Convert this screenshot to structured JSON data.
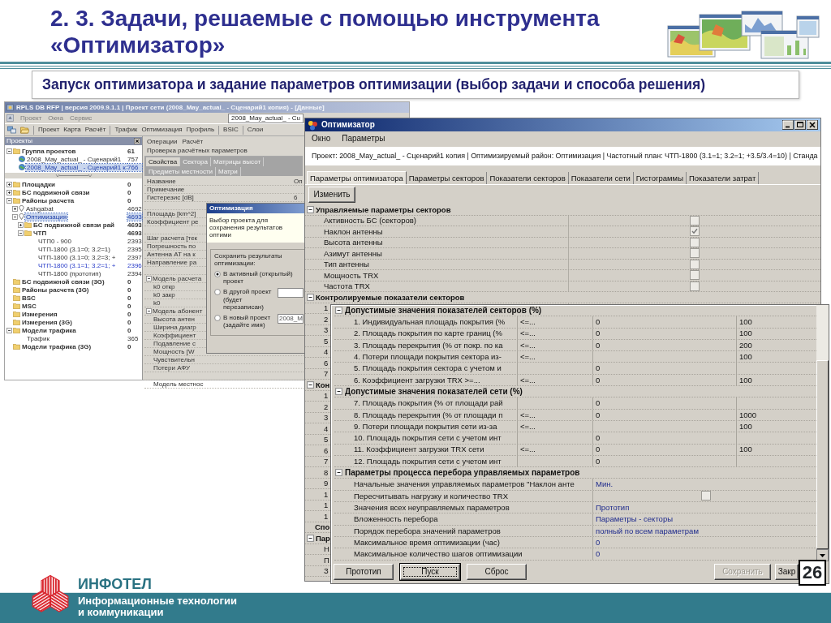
{
  "slide": {
    "title": "2. 3. Задачи, решаемые с помощью инструмента «Оптимизатор»",
    "subtitle": "Запуск оптимизатора и задание параметров оптимизации (выбор задачи и способа решения)",
    "page_number": "26"
  },
  "main_window": {
    "title": "RPLS DB RFP | версия 2009.9.1.1 | Проект сети (2008_May_actual_ - Сценарий1 копия) - [Данные]",
    "menu": [
      "Проект",
      "Окна",
      "Сервис"
    ],
    "toolbar": [
      "Проект",
      "Карта",
      "Расчёт",
      "Трафик",
      "Оптимизация",
      "Профиль",
      "BSIC",
      "Слои"
    ],
    "layer_combo": "2008_May_actual_ - Cu",
    "projects_panel": {
      "title": "Проекты",
      "tree": [
        {
          "label": "Группа проектов",
          "count": "61",
          "kind": "folder",
          "expanded": true,
          "selected": false,
          "children": [
            {
              "label": "2008_May_actual_ - Сценарий1",
              "count": "757",
              "kind": "project",
              "selected": false
            },
            {
              "label": "2008_May_actual_ - Сценарий1 к",
              "count": "766",
              "kind": "project",
              "selected": true
            }
          ]
        }
      ]
    },
    "objects_tree": [
      {
        "label": "Площадки",
        "count": "0",
        "kind": "folder",
        "expanded": false,
        "selected": false
      },
      {
        "label": "БС подвижной связи",
        "count": "0",
        "kind": "folder",
        "expanded": false,
        "selected": false
      },
      {
        "label": "Районы расчета",
        "count": "0",
        "kind": "folder",
        "expanded": true,
        "selected": false,
        "children": [
          {
            "label": "Ashgabat",
            "count": "4692",
            "kind": "area",
            "expanded": false,
            "selected": false
          },
          {
            "label": "Оптимизация",
            "count": "4693",
            "kind": "area",
            "expanded": true,
            "selected": true,
            "children": [
              {
                "label": "БС подвижной связи рай",
                "count": "4693",
                "kind": "folder",
                "expanded": false,
                "selected": false
              },
              {
                "label": "ЧТП",
                "count": "4693",
                "kind": "folder",
                "expanded": true,
                "selected": false,
                "children": [
                  {
                    "label": "ЧТП0 - 900",
                    "count": "2393",
                    "kind": "plan",
                    "selected": false,
                    "active": false
                  },
                  {
                    "label": "ЧТП-1800 (3.1=0; 3.2=1)",
                    "count": "2395",
                    "kind": "plan",
                    "selected": false,
                    "active": false
                  },
                  {
                    "label": "ЧТП-1800 (3.1=0; 3.2=3; +",
                    "count": "2397",
                    "kind": "plan",
                    "selected": false,
                    "active": false
                  },
                  {
                    "label": "ЧТП-1800 (3.1=1; 3.2=1; +",
                    "count": "2396",
                    "kind": "plan",
                    "selected": false,
                    "active": true
                  },
                  {
                    "label": "ЧТП-1800 (прототип)",
                    "count": "2394",
                    "kind": "plan",
                    "selected": false,
                    "active": false
                  }
                ]
              }
            ]
          }
        ]
      },
      {
        "label": "БС подвижной связи (3G)",
        "count": "0",
        "kind": "folder",
        "selected": false
      },
      {
        "label": "Районы расчета (3G)",
        "count": "0",
        "kind": "folder",
        "selected": false
      },
      {
        "label": "BSC",
        "count": "0",
        "kind": "folder",
        "selected": false
      },
      {
        "label": "MSC",
        "count": "0",
        "kind": "folder",
        "selected": false
      },
      {
        "label": "Измерения",
        "count": "0",
        "kind": "folder",
        "selected": false
      },
      {
        "label": "Измерения (3G)",
        "count": "0",
        "kind": "folder",
        "selected": false
      },
      {
        "label": "Модели трафика",
        "count": "0",
        "kind": "folder",
        "expanded": true,
        "selected": false,
        "children": [
          {
            "label": "Трафик",
            "count": "365",
            "kind": "plan",
            "selected": false
          }
        ]
      },
      {
        "label": "Модели трафика (3G)",
        "count": "0",
        "kind": "folder",
        "selected": false
      }
    ],
    "actions": [
      "Операции",
      "Расчёт",
      "Проверка расчётных параметров"
    ],
    "tabs": [
      {
        "label": "Свойства",
        "selected": true
      },
      {
        "label": "Сектора",
        "selected": false
      },
      {
        "label": "Матрицы высот",
        "selected": false
      },
      {
        "label": "Предметы местности",
        "selected": false
      },
      {
        "label": "Матри",
        "selected": false
      }
    ],
    "properties": [
      {
        "kind": "row",
        "name": "Название",
        "value": "Оп"
      },
      {
        "kind": "row",
        "name": "Примечание"
      },
      {
        "kind": "row",
        "name": "Гистерезис [dB]",
        "value": "6"
      },
      {
        "kind": "spacer"
      },
      {
        "kind": "row",
        "name": "Площадь [km^2]"
      },
      {
        "kind": "row",
        "name": "Коэффициент ре"
      },
      {
        "kind": "spacer"
      },
      {
        "kind": "row",
        "name": "Шаг расчета [тек"
      },
      {
        "kind": "row",
        "name": "Погрешность по"
      },
      {
        "kind": "row",
        "name": "Антенна АТ на к"
      },
      {
        "kind": "row",
        "name": "Направление ра"
      },
      {
        "kind": "spacer"
      },
      {
        "kind": "section",
        "name": "Модель расчета",
        "expanded": true
      },
      {
        "kind": "row",
        "name": "k0 откр"
      },
      {
        "kind": "row",
        "name": "k0 закр"
      },
      {
        "kind": "row",
        "name": "k0"
      },
      {
        "kind": "section",
        "name": "Модель абонент",
        "expanded": true
      },
      {
        "kind": "row",
        "name": "Высота антен"
      },
      {
        "kind": "row",
        "name": "Ширина диагр"
      },
      {
        "kind": "row",
        "name": "Коэффициент"
      },
      {
        "kind": "row",
        "name": "Подавление с"
      },
      {
        "kind": "row",
        "name": "Мощность [W"
      },
      {
        "kind": "row",
        "name": "Чувствительн"
      },
      {
        "kind": "row",
        "name": "Потери АФУ"
      },
      {
        "kind": "spacer"
      },
      {
        "kind": "row",
        "name": "Модель местнос"
      }
    ]
  },
  "save_dialog": {
    "title": "Оптимизация",
    "hint": "Выбор проекта для сохранения результатов оптими",
    "group": "Сохранить результаты оптимизации:",
    "options": [
      {
        "label": "В активный (открытый) проект",
        "selected": true,
        "kind": "plain"
      },
      {
        "label": "В другой проект (будет перезаписан)",
        "selected": false,
        "kind": "dropdown"
      },
      {
        "label": "В новый проект (задайте имя)",
        "selected": false,
        "kind": "input",
        "value": "2008_M"
      }
    ]
  },
  "optimizer": {
    "title": "Оптимизатор",
    "menu": [
      "Окно",
      "Параметры"
    ],
    "info": "Проект: 2008_May_actual_ - Сценарий1 копия | Оптимизируемый район: Оптимизация | Частотный план: ЧТП-1800 (3.1=1; 3.2=1; +3.5/3.4=10) | Станда",
    "tabs": [
      {
        "label": "Параметры оптимизатора",
        "selected": true
      },
      {
        "label": "Параметры секторов",
        "selected": false
      },
      {
        "label": "Показатели секторов",
        "selected": false
      },
      {
        "label": "Показатели сети",
        "selected": false
      },
      {
        "label": "Гистограммы",
        "selected": false
      },
      {
        "label": "Показатели затрат",
        "selected": false
      }
    ],
    "edit_button": "Изменить",
    "grid": [
      {
        "kind": "section",
        "label": "Управляемые параметры секторов",
        "expanded": true
      },
      {
        "kind": "check",
        "label": "Активность БС (секторов)",
        "checked": false
      },
      {
        "kind": "check",
        "label": "Наклон антенны",
        "checked": true
      },
      {
        "kind": "check",
        "label": "Высота антенны",
        "checked": false
      },
      {
        "kind": "check",
        "label": "Азимут антенны",
        "checked": false
      },
      {
        "kind": "check",
        "label": "Тип антенны",
        "checked": false
      },
      {
        "kind": "check",
        "label": "Мощность TRX",
        "checked": false
      },
      {
        "kind": "check",
        "label": "Частота TRX",
        "checked": false
      },
      {
        "kind": "section",
        "label": "Контролируемые показатели секторов",
        "expanded": true
      },
      {
        "kind": "row",
        "label": "1"
      },
      {
        "kind": "row",
        "label": "2"
      },
      {
        "kind": "row",
        "label": "3"
      },
      {
        "kind": "row",
        "label": "5"
      },
      {
        "kind": "row",
        "label": "4"
      },
      {
        "kind": "row",
        "label": "6"
      },
      {
        "kind": "row",
        "label": "7"
      },
      {
        "kind": "section",
        "label": "Кон",
        "expanded": true
      },
      {
        "kind": "row",
        "label": "1"
      },
      {
        "kind": "row",
        "label": "2"
      },
      {
        "kind": "row",
        "label": "3"
      },
      {
        "kind": "row",
        "label": "4"
      },
      {
        "kind": "row",
        "label": "5"
      },
      {
        "kind": "row",
        "label": "6"
      },
      {
        "kind": "row",
        "label": "7"
      },
      {
        "kind": "row",
        "label": "8"
      },
      {
        "kind": "row",
        "label": "9"
      },
      {
        "kind": "row",
        "label": "1"
      },
      {
        "kind": "row",
        "label": "1"
      },
      {
        "kind": "row",
        "label": "1"
      },
      {
        "kind": "heading",
        "label": "Спо"
      },
      {
        "kind": "section",
        "label": "Пар",
        "expanded": true
      },
      {
        "kind": "row",
        "label": "Н"
      },
      {
        "kind": "row",
        "label": "П"
      },
      {
        "kind": "row",
        "label": "З"
      }
    ]
  },
  "detail_panel": {
    "sections": [
      {
        "label": "Допустимые значения показателей секторов (%)",
        "expanded": true,
        "rows": [
          {
            "kind": "limit",
            "name": "1. Индивидуальная площадь покрытия (%",
            "condition": "<=...",
            "min": "0",
            "max": "100"
          },
          {
            "kind": "limit",
            "name": "2. Площадь покрытия по карте границ (%",
            "condition": "<=...",
            "min": "0",
            "max": "100"
          },
          {
            "kind": "limit",
            "name": "3. Площадь перекрытия (% от покр. по ка",
            "condition": "<=...",
            "min": "0",
            "max": "200"
          },
          {
            "kind": "limit",
            "name": "4. Потери площади покрытия сектора из-",
            "condition": "<=...",
            "max": "100"
          },
          {
            "kind": "limit",
            "name": "5. Площадь покрытия сектора с учетом и",
            "min": "0"
          },
          {
            "kind": "limit",
            "name": "6. Коэффициент загрузки TRX >=...",
            "condition": "<=...",
            "min": "0",
            "max": "100"
          }
        ]
      },
      {
        "label": "Допустимые значения показателей сети (%)",
        "expanded": true,
        "rows": [
          {
            "kind": "limit",
            "name": "7. Площадь покрытия (% от площади рай",
            "min": "0"
          },
          {
            "kind": "limit",
            "name": "8. Площадь перекрытия (% от площади п",
            "condition": "<=...",
            "min": "0",
            "max": "1000"
          },
          {
            "kind": "limit",
            "name": "9. Потери площади покрытия сети из-за",
            "condition": "<=...",
            "max": "100"
          },
          {
            "kind": "limit",
            "name": "10. Площадь покрытия сети с учетом инт",
            "min": "0"
          },
          {
            "kind": "limit",
            "name": "11. Коэффициент загрузки TRX сети",
            "condition": "<=...",
            "min": "0",
            "max": "100"
          },
          {
            "kind": "limit",
            "name": "12. Площадь покрытия сети с учетом инт",
            "min": "0"
          }
        ]
      },
      {
        "label": "Параметры процесса перебора управляемых параметров",
        "expanded": true,
        "rows": [
          {
            "kind": "value",
            "name": "Начальные значения управляемых параметров \"Наклон анте",
            "value": "Мин."
          },
          {
            "kind": "check",
            "name": "Пересчитывать нагрузку и количество TRX",
            "checked": false
          },
          {
            "kind": "value",
            "name": "Значения всех неуправляемых параметров",
            "value": "Прототип"
          },
          {
            "kind": "value",
            "name": "Вложенность перебора",
            "value": "Параметры - секторы"
          },
          {
            "kind": "value",
            "name": "Порядок перебора значений параметров",
            "value": "полный по всем параметрам"
          },
          {
            "kind": "value",
            "name": "Максимальное время оптимизации (час)",
            "value": "0"
          },
          {
            "kind": "value",
            "name": "Максимальное количество шагов оптимизации",
            "value": "0"
          }
        ]
      }
    ],
    "run_buttons": [
      {
        "label": "Прототип",
        "default": false
      },
      {
        "label": "Пуск",
        "default": true
      },
      {
        "label": "Сброс",
        "default": false
      }
    ],
    "result_buttons": [
      {
        "label": "Сохранить",
        "disabled": true
      },
      {
        "label": "Закр",
        "disabled": false
      }
    ]
  },
  "footer": {
    "company": "ИНФОТЕЛ",
    "tagline": "Информационные технологии и коммуникации"
  }
}
